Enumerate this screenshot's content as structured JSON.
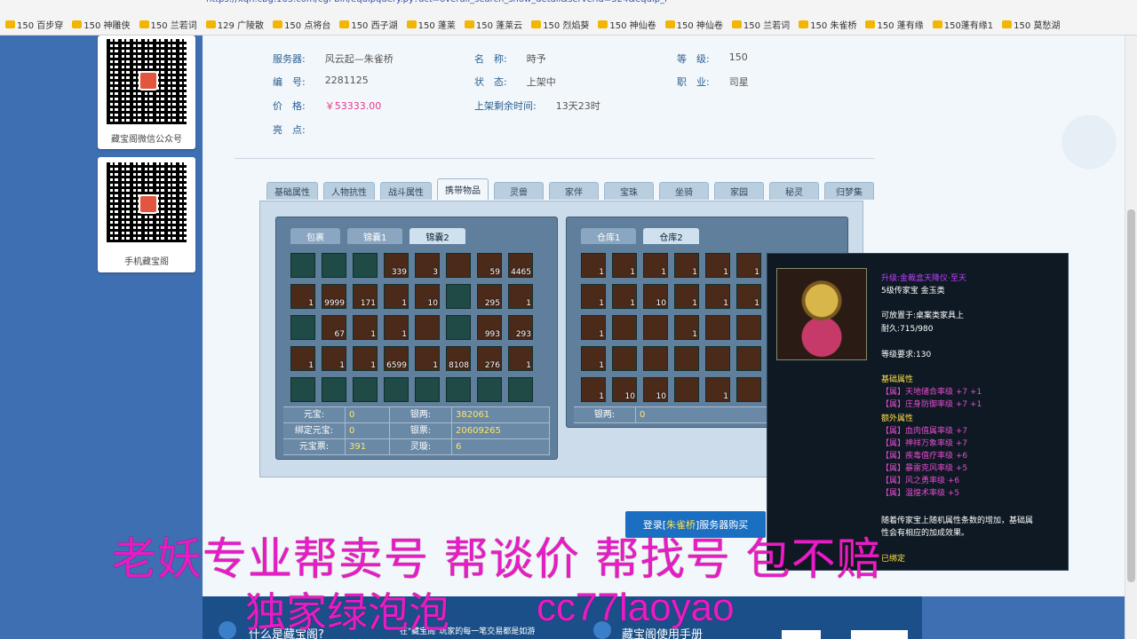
{
  "browser": {
    "url": "https://xqh.cbg.163.com/cgi-bin/equipquery.py?act=overall_search_show_detail&serverid=524&equip_i",
    "bookmarks": [
      "150 百步穿",
      "150 神雕侠",
      "150 兰若词",
      "129 广陵散",
      "150 点将台",
      "150 西子湖",
      "150 蓬莱",
      "150 蓬莱云",
      "150 烈焰葵",
      "150 神仙卷",
      "150 神仙卷",
      "150 兰若词",
      "150 朱雀桥",
      "150 蓬有缘",
      "150蓬有缘1",
      "150 莫愁湖"
    ]
  },
  "sidebar": {
    "qr1_label": "藏宝阁微信公众号",
    "qr2_label": "手机藏宝阁"
  },
  "info": {
    "server_label": "服务器:",
    "server": "风云起—朱雀桥",
    "name_label": "名　称:",
    "name": "時予",
    "level_label": "等　级:",
    "level": "150",
    "id_label": "编　号:",
    "id": "2281125",
    "status_label": "状　态:",
    "status": "上架中",
    "job_label": "职　业:",
    "job": "司星",
    "price_label": "价　格:",
    "price": "￥53333.00",
    "time_label": "上架剩余时间:",
    "time": "13天23时",
    "highlight_label": "亮　点:"
  },
  "tabs": [
    "基础属性",
    "人物抗性",
    "战斗属性",
    "携带物品",
    "灵兽",
    "家伴",
    "宝珠",
    "坐骑",
    "家园",
    "秘灵",
    "归梦集"
  ],
  "active_tab": 3,
  "bag": {
    "subtabs": [
      "包裹",
      "锦囊1",
      "锦囊2"
    ],
    "active": 2,
    "quantities": [
      "",
      "",
      "",
      "339",
      "3",
      "",
      "59",
      "4465",
      "1",
      "9999",
      "171",
      "1",
      "10",
      "",
      "295",
      "1",
      "",
      "67",
      "1",
      "1",
      "",
      "",
      "993",
      "293",
      "1",
      "1",
      "1",
      "6599",
      "1",
      "8108",
      "276",
      "1",
      "",
      "",
      "",
      "",
      "",
      "",
      "",
      ""
    ],
    "stats": [
      {
        "k1": "元宝:",
        "v1": "0",
        "k2": "银两:",
        "v2": "382061"
      },
      {
        "k1": "绑定元宝:",
        "v1": "0",
        "k2": "银票:",
        "v2": "20609265"
      },
      {
        "k1": "元宝票:",
        "v1": "391",
        "k2": "灵璇:",
        "v2": "6"
      }
    ]
  },
  "warehouse": {
    "subtabs": [
      "仓库1",
      "仓库2"
    ],
    "active": 1,
    "quantities": [
      "1",
      "1",
      "1",
      "1",
      "1",
      "1",
      "1",
      "1",
      "10",
      "1",
      "1",
      "1",
      "1",
      "",
      "",
      "1",
      "",
      "",
      "1",
      "",
      "",
      "",
      "",
      "",
      "1",
      "10",
      "10",
      "",
      "1",
      ""
    ],
    "silver_label": "银两:",
    "silver": "0"
  },
  "tooltip": {
    "title": "升级:金裁盒天降仪·至天",
    "type": "5级传家宝 金玉类",
    "place": "可放置于:桌案类家具上",
    "durability": "耐久:715/980",
    "req": "等级要求:130",
    "base_title": "基础属性",
    "base": [
      "【属】天地储合率级 +7 +1",
      "【属】庄身防御率级 +7 +1"
    ],
    "extra_title": "额外属性",
    "extra": [
      "【属】血肉值属率级 +7",
      "【属】神祥万象率级 +7",
      "【属】疾毒值疗率级 +6",
      "【属】暴雷克风率级 +5",
      "【属】风之勇率级 +6",
      "【属】温煌术率级 +5"
    ],
    "desc1": "随着传家宝上随机属性条数的增加，基础属",
    "desc2": "性会有相应的加成效果。",
    "bound": "已绑定"
  },
  "buy_button": {
    "pre": "登录[",
    "server": "朱雀桥",
    "post": "]服务器购买"
  },
  "footer": {
    "q": "什么是藏宝阁?",
    "mid": "在\"藏宝阁\"玩家的每一笔交易都是如游",
    "guide": "藏宝阁使用手册"
  },
  "watermark": {
    "line1": "老妖专业帮卖号 帮谈价 帮找号 包不赔",
    "line2": "独家绿泡泡",
    "line3": "cc77laoyao"
  },
  "colors": {
    "watermark": "#e61cc8",
    "price": "#e8388a",
    "page_bg": "#3f6fb3"
  }
}
